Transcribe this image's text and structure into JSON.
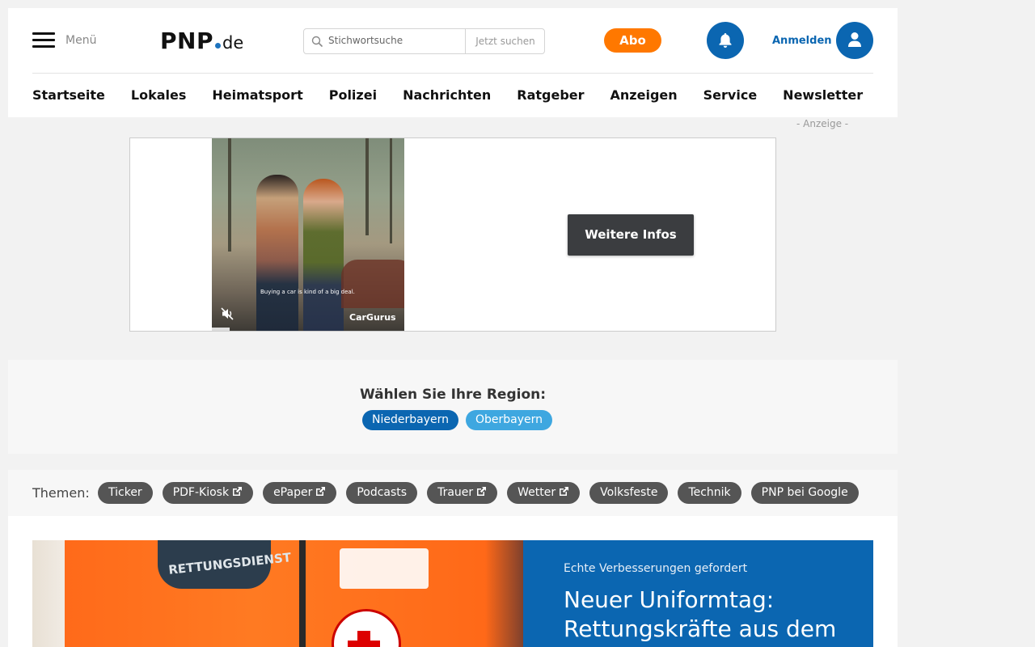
{
  "header": {
    "menu_label": "Menü",
    "logo": {
      "main": "PNP",
      "suffix": "de"
    },
    "search": {
      "placeholder": "Stichwortsuche",
      "button_label": "Jetzt suchen"
    },
    "abo_label": "Abo",
    "login_label": "Anmelden",
    "icons": {
      "menu": "hamburger-icon",
      "search": "search-icon",
      "bell": "bell-icon",
      "user": "user-icon"
    }
  },
  "nav": {
    "items": [
      "Startseite",
      "Lokales",
      "Heimatsport",
      "Polizei",
      "Nachrichten",
      "Ratgeber",
      "Anzeigen",
      "Service",
      "Newsletter"
    ]
  },
  "ad": {
    "label": "- Anzeige -",
    "caption": "Buying a car is kind of a big deal.",
    "brand": "CarGurus",
    "cta_label": "Weitere Infos"
  },
  "region": {
    "title": "Wählen Sie Ihre Region:",
    "options": [
      "Niederbayern",
      "Oberbayern"
    ]
  },
  "themes": {
    "label": "Themen:",
    "items": [
      {
        "label": "Ticker",
        "external": false
      },
      {
        "label": "PDF-Kiosk",
        "external": true
      },
      {
        "label": "ePaper",
        "external": true
      },
      {
        "label": "Podcasts",
        "external": false
      },
      {
        "label": "Trauer",
        "external": true
      },
      {
        "label": "Wetter",
        "external": true
      },
      {
        "label": "Volksfeste",
        "external": false
      },
      {
        "label": "Technik",
        "external": false
      },
      {
        "label": "PNP bei Google",
        "external": false
      }
    ]
  },
  "teaser": {
    "kicker": "Echte Verbesserungen gefordert",
    "headline": "Neuer Uniformtag: Rettungskräfte aus dem",
    "image_text": "RETTUNGSDIENST"
  },
  "colors": {
    "brand_blue": "#0b66b1",
    "abo_orange": "#ff7800",
    "region_light_blue": "#3ea7e0",
    "theme_pill_gray": "#555555"
  }
}
